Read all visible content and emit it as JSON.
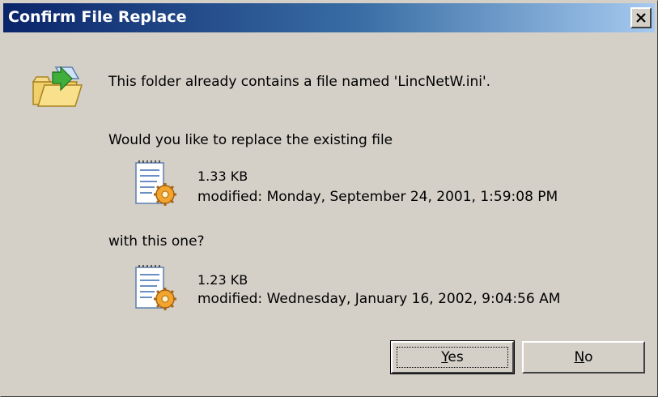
{
  "dialog": {
    "title": "Confirm File Replace",
    "close_icon": "close-icon",
    "message": "This folder already contains a file named 'LincNetW.ini'.",
    "replace_prompt": "Would you like to replace the existing file",
    "existing_file": {
      "size": "1.33 KB",
      "modified": "modified: Monday, September 24, 2001, 1:59:08 PM"
    },
    "with_prompt": "with this one?",
    "new_file": {
      "size": "1.23 KB",
      "modified": "modified: Wednesday, January 16, 2002, 9:04:56 AM"
    },
    "buttons": {
      "yes": "Yes",
      "no": "No"
    }
  },
  "colors": {
    "titlebar_start": "#0a246a",
    "titlebar_end": "#a6caf0",
    "face": "#d4d0c8"
  },
  "icons": [
    "folder-copy-icon",
    "ini-file-icon"
  ]
}
